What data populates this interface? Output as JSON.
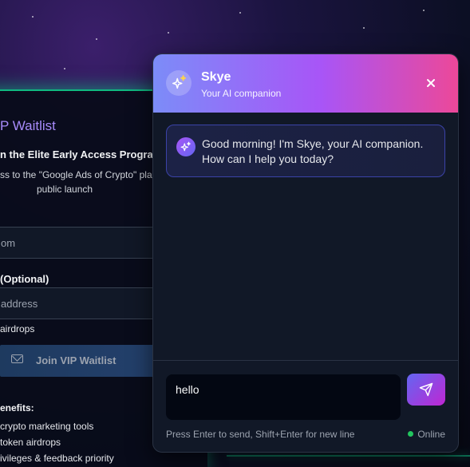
{
  "colors": {
    "accent_start": "#7c8cf8",
    "accent_end": "#ec4899",
    "online": "#22c55e",
    "waitlist_accent": "#10b981"
  },
  "waitlist": {
    "title": "P Waitlist",
    "subtitle": "n the Elite Early Access Progra",
    "description_line1": "ss to the \"Google Ads of Crypto\" pla",
    "description_line2": "public launch",
    "email_placeholder": "om",
    "wallet_label": "(Optional)",
    "wallet_placeholder": "address",
    "airdrop_text": "airdrops",
    "join_button": "Join VIP Waitlist",
    "join_icon": "mail-icon",
    "benefits_heading": "enefits:",
    "benefits": [
      "crypto marketing tools",
      "token airdrops",
      "ivileges & feedback priority"
    ]
  },
  "chat": {
    "name": "Skye",
    "tagline": "Your AI companion",
    "avatar_icon": "sparkles-icon",
    "close_icon": "close-icon",
    "messages": [
      {
        "sender": "bot",
        "text": "Good morning! I'm Skye, your AI companion. How can I help you today?"
      }
    ],
    "input_value": "hello",
    "send_icon": "send-icon",
    "hint": "Press Enter to send, Shift+Enter for new line",
    "status": "Online"
  }
}
